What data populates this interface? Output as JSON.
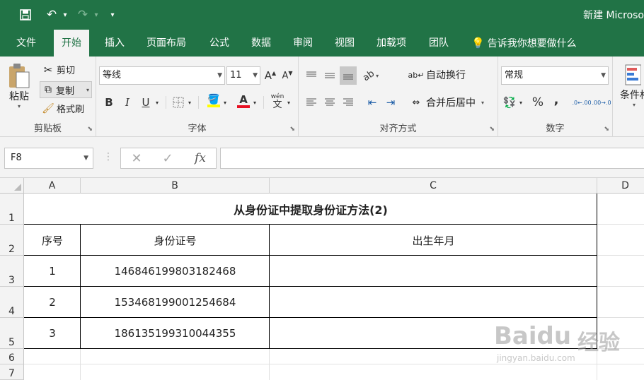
{
  "titlebar": {
    "doc_title": "新建 Microso"
  },
  "tabs": [
    "文件",
    "开始",
    "插入",
    "页面布局",
    "公式",
    "数据",
    "审阅",
    "视图",
    "加载项",
    "团队"
  ],
  "tell_me": "告诉我你想要做什么",
  "ribbon": {
    "clipboard": {
      "paste": "粘贴",
      "cut": "剪切",
      "copy": "复制",
      "format_painter": "格式刷",
      "label": "剪贴板"
    },
    "font": {
      "font_name": "等线",
      "font_size": "11",
      "bold": "B",
      "italic": "I",
      "underline": "U",
      "label": "字体",
      "grow": "A",
      "shrink": "A",
      "phonetic": "wén"
    },
    "alignment": {
      "wrap_text": "自动换行",
      "merge_center": "合并后居中",
      "label": "对齐方式"
    },
    "number": {
      "format": "常规",
      "percent": "%",
      "comma": ",",
      "inc_decimal": ".0←.00",
      "dec_decimal": ".00→.0",
      "label": "数字"
    },
    "styles": {
      "conditional": "条件格"
    }
  },
  "formula_bar": {
    "name_box": "F8",
    "fx": "fx"
  },
  "columns": [
    "A",
    "B",
    "C",
    "D"
  ],
  "rows": [
    "1",
    "2",
    "3",
    "4",
    "5",
    "6",
    "7"
  ],
  "sheet": {
    "title": "从身份证中提取身份证方法(2)",
    "headers": [
      "序号",
      "身份证号",
      "出生年月"
    ],
    "data": [
      {
        "no": "1",
        "id": "146846199803182468",
        "birth": ""
      },
      {
        "no": "2",
        "id": "153468199001254684",
        "birth": ""
      },
      {
        "no": "3",
        "id": "186135199310044355",
        "birth": ""
      }
    ]
  },
  "watermark": {
    "brand": "Baidu",
    "cn": "经验",
    "url": "jingyan.baidu.com"
  }
}
